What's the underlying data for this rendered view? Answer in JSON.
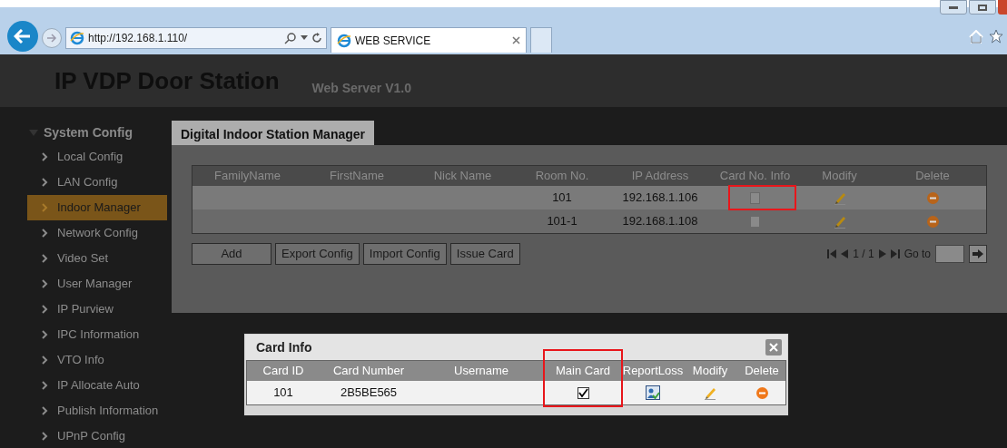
{
  "browser": {
    "address": "http://192.168.1.110/",
    "tab_title": "WEB SERVICE"
  },
  "header": {
    "title": "IP VDP Door Station",
    "subtitle": "Web Server V1.0"
  },
  "sidebar": {
    "title": "System Config",
    "expanded": true,
    "items": [
      {
        "label": "Local Config",
        "selected": false
      },
      {
        "label": "LAN Config",
        "selected": false
      },
      {
        "label": "Indoor Manager",
        "selected": true
      },
      {
        "label": "Network Config",
        "selected": false
      },
      {
        "label": "Video Set",
        "selected": false
      },
      {
        "label": "User Manager",
        "selected": false
      },
      {
        "label": "IP Purview",
        "selected": false
      },
      {
        "label": "IPC Information",
        "selected": false
      },
      {
        "label": "VTO Info",
        "selected": false
      },
      {
        "label": "IP Allocate Auto",
        "selected": false
      },
      {
        "label": "Publish Information",
        "selected": false
      },
      {
        "label": "UPnP Config",
        "selected": false
      }
    ]
  },
  "panel": {
    "tab": "Digital Indoor Station Manager",
    "table": {
      "columns": [
        {
          "label": "FamilyName",
          "highlighted": false
        },
        {
          "label": "FirstName",
          "highlighted": false
        },
        {
          "label": "Nick Name",
          "highlighted": false
        },
        {
          "label": "Room No.",
          "highlighted": false
        },
        {
          "label": "IP Address",
          "highlighted": false
        },
        {
          "label": "Card No. Info",
          "highlighted": true
        },
        {
          "label": "Modify",
          "highlighted": false
        },
        {
          "label": "Delete",
          "highlighted": false
        }
      ],
      "rows": [
        {
          "room": "101",
          "ip": "192.168.1.106",
          "selected": true
        },
        {
          "room": "101-1",
          "ip": "192.168.1.108",
          "selected": false
        }
      ]
    },
    "buttons": [
      "Add",
      "Export Config",
      "Import Config",
      "Issue Card"
    ],
    "pager": {
      "page": "1 / 1",
      "goto_label": "Go to"
    }
  },
  "dialog": {
    "title": "Card Info",
    "columns": [
      {
        "label": "Card ID",
        "highlighted": false
      },
      {
        "label": "Card Number",
        "highlighted": false
      },
      {
        "label": "Username",
        "highlighted": false
      },
      {
        "label": "Main Card",
        "highlighted": true
      },
      {
        "label": "ReportLoss",
        "highlighted": false
      },
      {
        "label": "Modify",
        "highlighted": false
      },
      {
        "label": "Delete",
        "highlighted": false
      }
    ],
    "rows": [
      {
        "card_id": "101",
        "card_number": "2B5BE565",
        "main_card": true
      }
    ]
  }
}
